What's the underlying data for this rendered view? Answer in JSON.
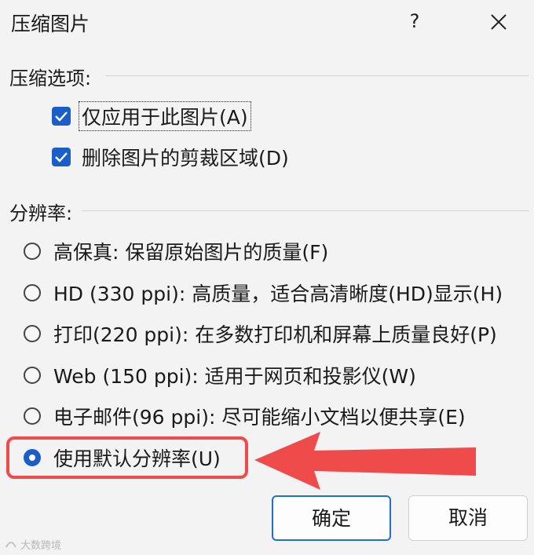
{
  "dialog": {
    "title": "压缩图片",
    "help_label": "?",
    "close_icon": "close-icon"
  },
  "compress_options": {
    "label": "压缩选项:",
    "items": [
      {
        "label": "仅应用于此图片(A)",
        "checked": true
      },
      {
        "label": "删除图片的剪裁区域(D)",
        "checked": true
      }
    ]
  },
  "resolution": {
    "label": "分辨率:",
    "options": [
      {
        "label": "高保真: 保留原始图片的质量(F)",
        "selected": false
      },
      {
        "label": "HD (330 ppi): 高质量，适合高清晰度(HD)显示(H)",
        "selected": false
      },
      {
        "label": "打印(220 ppi): 在多数打印机和屏幕上质量良好(P)",
        "selected": false
      },
      {
        "label": "Web (150 ppi): 适用于网页和投影仪(W)",
        "selected": false
      },
      {
        "label": "电子邮件(96 ppi): 尽可能缩小文档以便共享(E)",
        "selected": false
      },
      {
        "label": "使用默认分辨率(U)",
        "selected": true
      }
    ]
  },
  "buttons": {
    "ok": "确定",
    "cancel": "取消"
  },
  "annotation": {
    "highlight_color": "#ef4b4b",
    "accent_color": "#1a5ec9"
  },
  "watermark": "大数跨境"
}
